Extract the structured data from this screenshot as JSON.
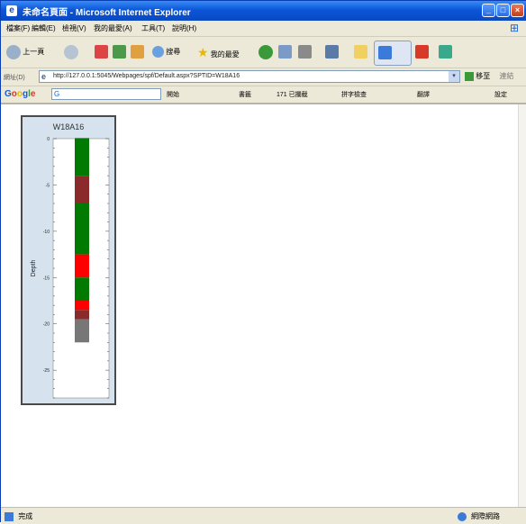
{
  "window": {
    "title": "未命名頁面 - Microsoft Internet Explorer",
    "buttons": [
      "minimize",
      "maximize",
      "close"
    ]
  },
  "menu": [
    "檔案(F)",
    "編輯(E)",
    "檢視(V)",
    "我的最愛(A)",
    "工具(T)",
    "說明(H)"
  ],
  "toolbar": {
    "back_label": "上一頁",
    "search_label": "搜尋",
    "favorites_label": "我的最愛"
  },
  "address": {
    "label": "網址(D)",
    "url": "http://127.0.0.1:5045/Webpages/spf/Default.aspx?SPTID=W18A16",
    "go_label": "移至",
    "links_label": "連結"
  },
  "google": {
    "logo": "Google",
    "search_value": "G",
    "items": [
      "開始",
      "書籤",
      "171 已攔截",
      "拼字檢查",
      "翻譯",
      "設定"
    ]
  },
  "status": {
    "left": "完成",
    "right": "網際網路"
  },
  "chart_data": {
    "type": "log",
    "title": "W18A16",
    "ylabel": "Depth",
    "ylim": [
      0,
      28
    ],
    "yticks": [
      0,
      5,
      10,
      15,
      20,
      25
    ],
    "ytick_labels": [
      "0",
      "-5",
      "-10",
      "-15",
      "-20",
      "-25"
    ],
    "intervals": [
      {
        "top": 0,
        "bottom": 4,
        "color": "#007a00"
      },
      {
        "top": 4,
        "bottom": 7,
        "color": "#8b2a2a"
      },
      {
        "top": 7,
        "bottom": 12.5,
        "color": "#007a00"
      },
      {
        "top": 12.5,
        "bottom": 15,
        "color": "#ff0000"
      },
      {
        "top": 15,
        "bottom": 17.5,
        "color": "#007a00"
      },
      {
        "top": 17.5,
        "bottom": 18.5,
        "color": "#ff0000"
      },
      {
        "top": 18.5,
        "bottom": 19.5,
        "color": "#8b2a2a"
      },
      {
        "top": 19.5,
        "bottom": 22,
        "color": "#777777"
      }
    ]
  }
}
